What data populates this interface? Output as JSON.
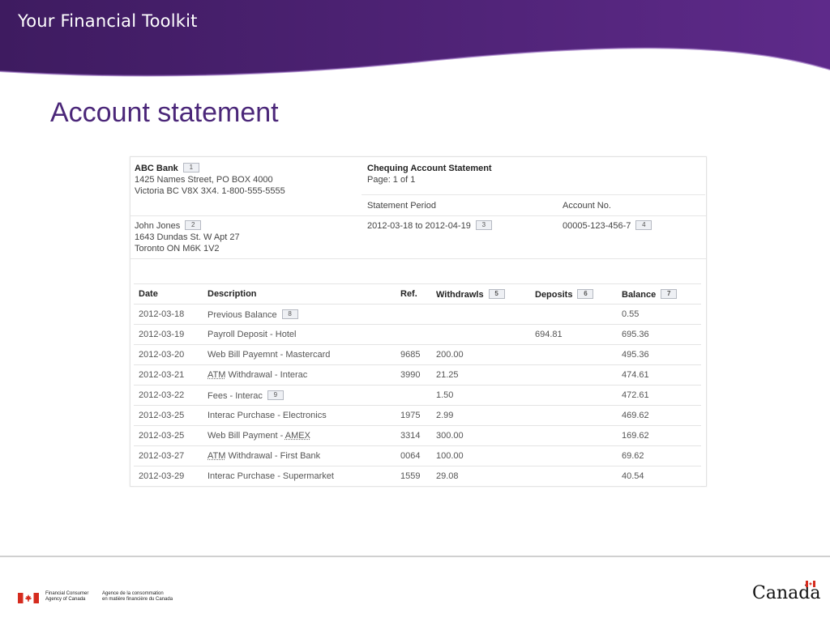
{
  "header": {
    "toolkit_title": "Your Financial Toolkit",
    "colors": {
      "banner_dark": "#3e1b60",
      "banner_light": "#5e2a8a",
      "title": "#4b2779"
    }
  },
  "slide": {
    "title": "Account statement"
  },
  "statement": {
    "bank": {
      "name": "ABC Bank",
      "note": "1",
      "address_line1": "1425 Names Street, PO BOX 4000",
      "address_line2": "Victoria BC V8X 3X4. 1-800-555-5555"
    },
    "doc": {
      "title": "Chequing Account Statement",
      "page": "Page: 1 of 1"
    },
    "period": {
      "label": "Statement Period",
      "value": "2012-03-18 to 2012-04-19",
      "note": "3"
    },
    "account": {
      "label": "Account No.",
      "value": "00005-123-456-7",
      "note": "4"
    },
    "customer": {
      "name": "John Jones",
      "note": "2",
      "address_line1": "1643 Dundas St. W Apt 27",
      "address_line2": "Toronto ON M6K 1V2"
    },
    "table": {
      "headers": {
        "date": "Date",
        "description": "Description",
        "ref": "Ref.",
        "withdrawals": "Withdrawls",
        "withdrawals_note": "5",
        "deposits": "Deposits",
        "deposits_note": "6",
        "balance": "Balance",
        "balance_note": "7"
      },
      "rows": [
        {
          "date": "2012-03-18",
          "description": "Previous Balance",
          "note": "8",
          "ref": "",
          "withdrawal": "",
          "deposit": "",
          "balance": "0.55"
        },
        {
          "date": "2012-03-19",
          "description": "Payroll Deposit - Hotel",
          "ref": "",
          "withdrawal": "",
          "deposit": "694.81",
          "balance": "695.36"
        },
        {
          "date": "2012-03-20",
          "description": "Web Bill Payemnt - Mastercard",
          "ref": "9685",
          "withdrawal": "200.00",
          "deposit": "",
          "balance": "495.36"
        },
        {
          "date": "2012-03-21",
          "desc_abbr": "ATM",
          "desc_rest": " Withdrawal - Interac",
          "ref": "3990",
          "withdrawal": "21.25",
          "deposit": "",
          "balance": "474.61"
        },
        {
          "date": "2012-03-22",
          "description": "Fees - Interac",
          "note": "9",
          "ref": "",
          "withdrawal": "1.50",
          "deposit": "",
          "balance": "472.61"
        },
        {
          "date": "2012-03-25",
          "description": "Interac Purchase - Electronics",
          "ref": "1975",
          "withdrawal": "2.99",
          "deposit": "",
          "balance": "469.62"
        },
        {
          "date": "2012-03-25",
          "desc_prefix": "Web Bill Payment - ",
          "desc_abbr": "AMEX",
          "ref": "3314",
          "withdrawal": "300.00",
          "deposit": "",
          "balance": "169.62"
        },
        {
          "date": "2012-03-27",
          "desc_abbr": "ATM",
          "desc_rest": " Withdrawal - First Bank",
          "ref": "0064",
          "withdrawal": "100.00",
          "deposit": "",
          "balance": "69.62"
        },
        {
          "date": "2012-03-29",
          "description": "Interac Purchase - Supermarket",
          "ref": "1559",
          "withdrawal": "29.08",
          "deposit": "",
          "balance": "40.54"
        }
      ]
    }
  },
  "footer": {
    "agency_en_line1": "Financial Consumer",
    "agency_en_line2": "Agency of Canada",
    "agency_fr_line1": "Agence de la consommation",
    "agency_fr_line2": "en matière financière du Canada",
    "wordmark": "Canada",
    "flag_color": "#d52b1e"
  }
}
